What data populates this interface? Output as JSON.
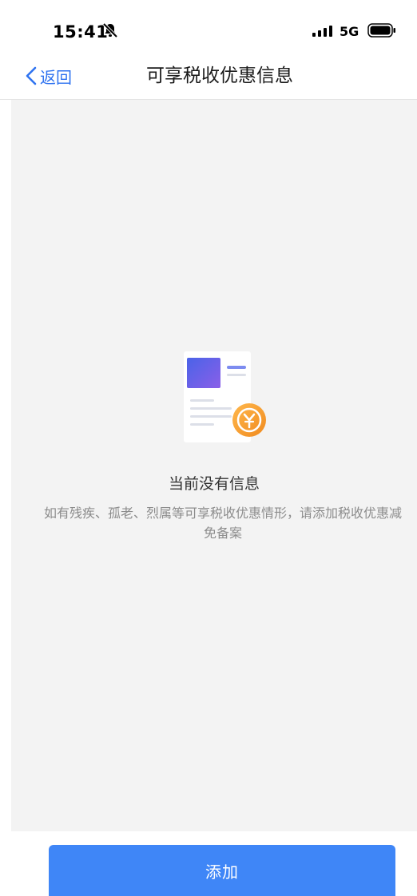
{
  "status_bar": {
    "time": "15:41",
    "network": "5G",
    "icons": [
      "bell-muted-icon",
      "signal-icon",
      "battery-icon"
    ]
  },
  "nav": {
    "back_label": "返回",
    "title": "可享税收优惠信息"
  },
  "empty_state": {
    "title": "当前没有信息",
    "description": "如有残疾、孤老、烈属等可享税收优惠情形，请添加税收优惠减免备案",
    "icon": "document-yuan-icon"
  },
  "footer": {
    "add_label": "添加"
  },
  "colors": {
    "accent": "#2f73f0",
    "button": "#3f86f7",
    "coin": "#f5a136"
  }
}
